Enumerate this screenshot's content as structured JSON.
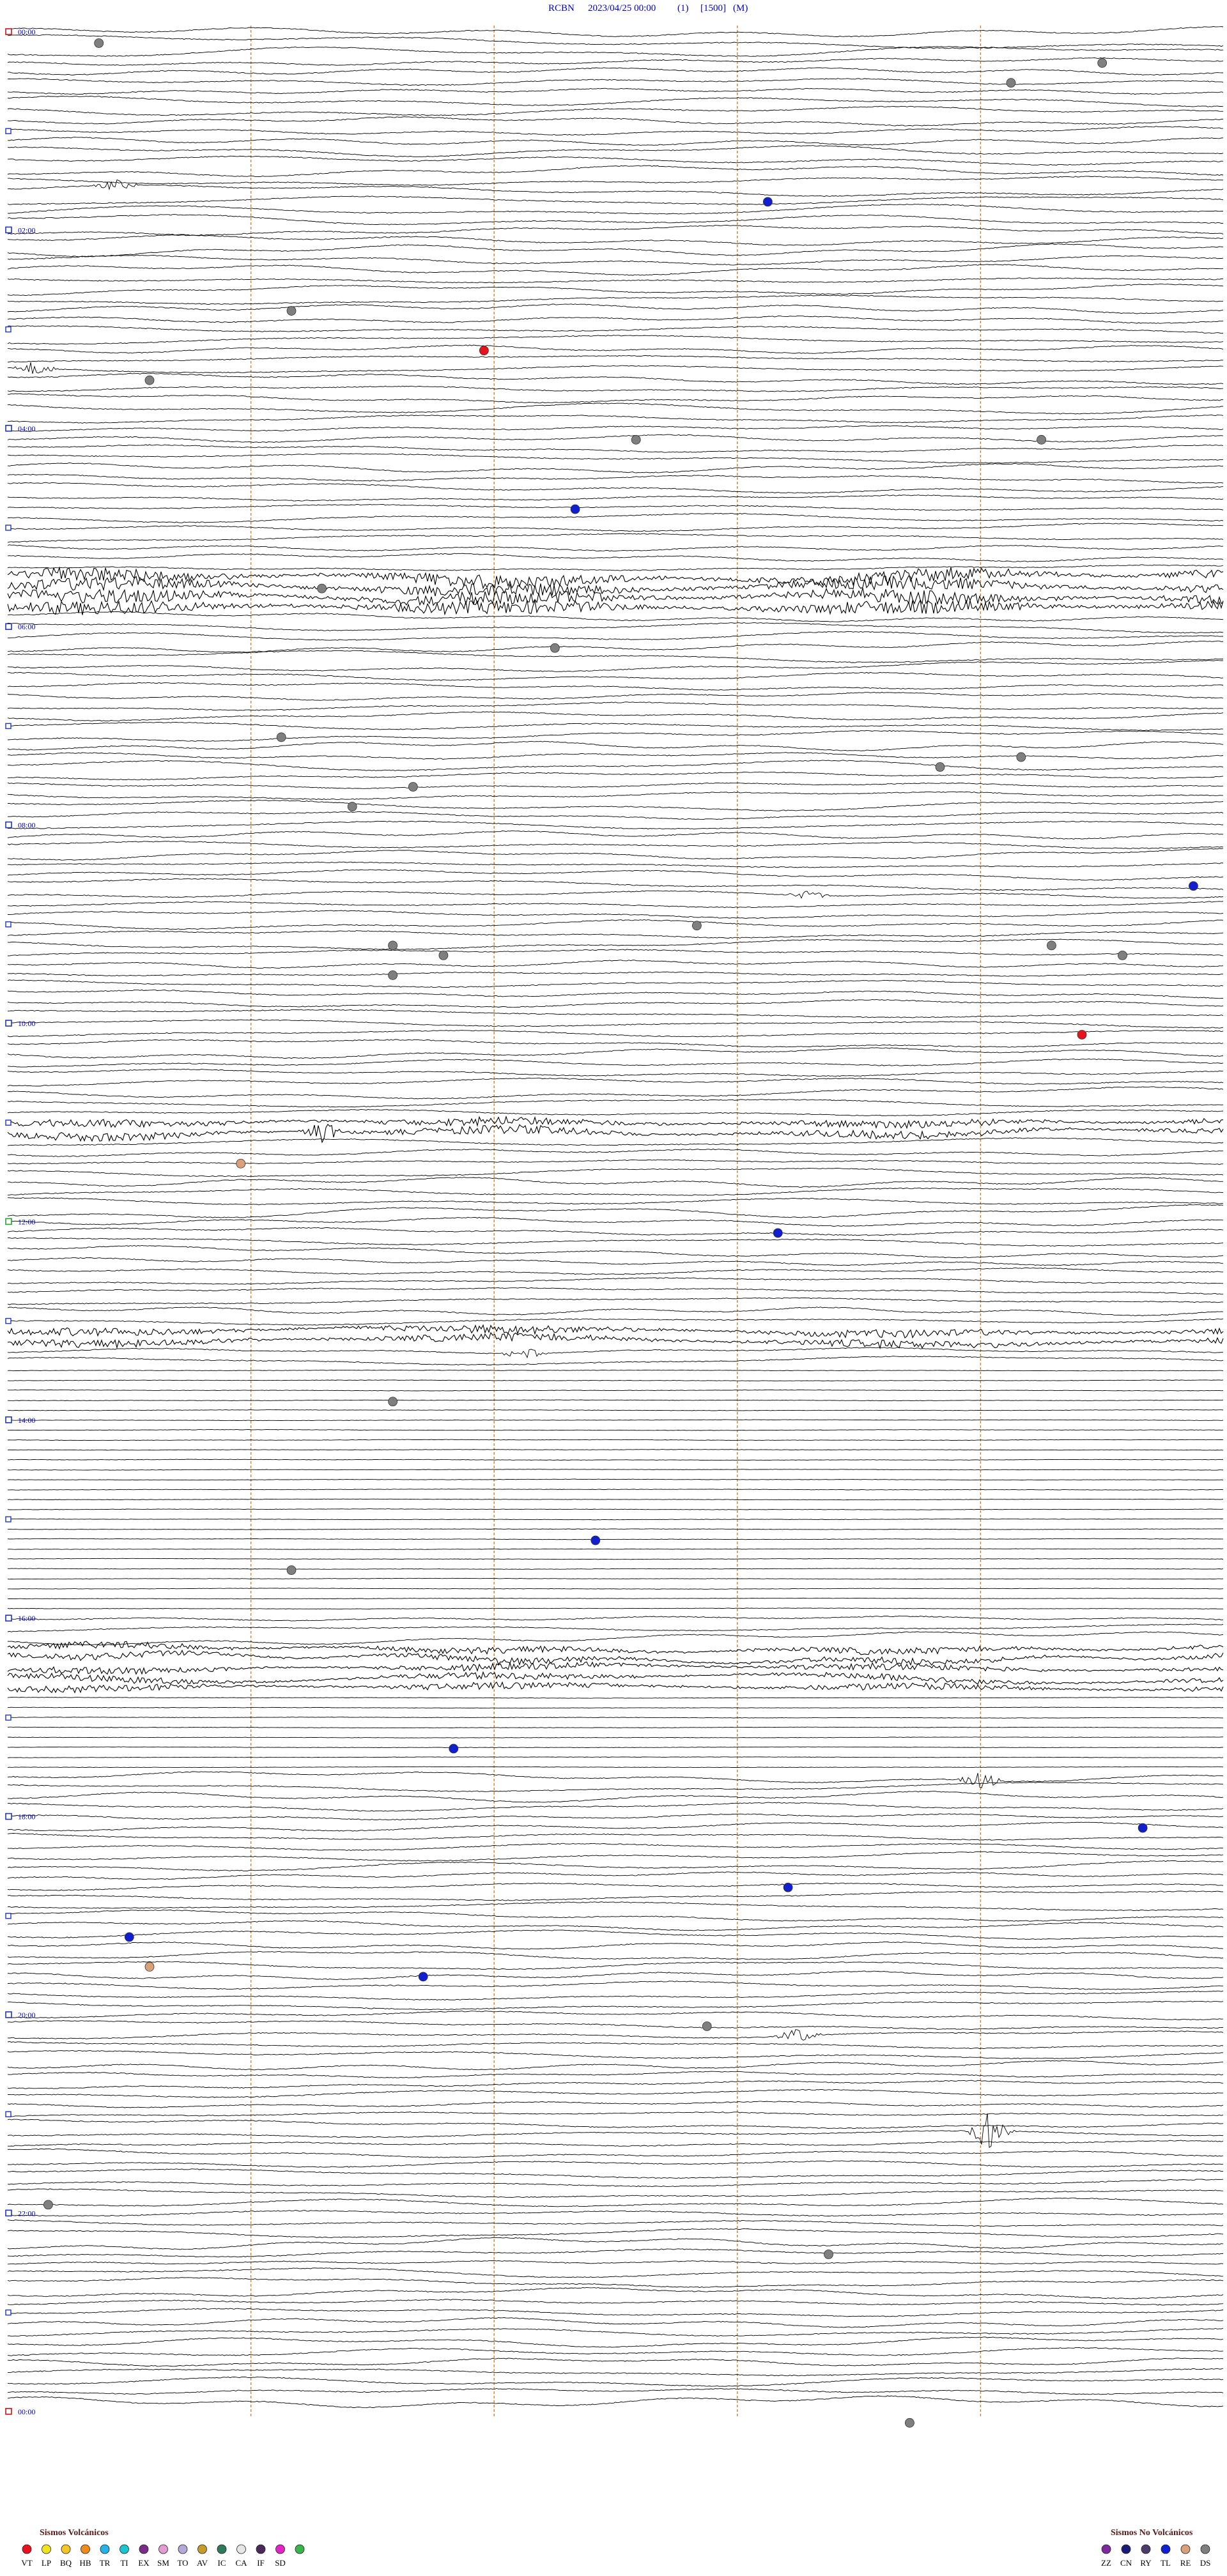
{
  "header": {
    "station": "RCBN",
    "date": "2023/04/25 00:00",
    "channel": "(1)",
    "scale": "[1500]",
    "mode": "(M)",
    "color": "#0000cc"
  },
  "chart_data": {
    "type": "seismogram-helicorder",
    "rows_total": 240,
    "row_minutes": 6,
    "hour_labels": [
      {
        "row": 0,
        "label": "00:00",
        "marker": "red"
      },
      {
        "row": 20,
        "label": "02:00",
        "marker": "blue"
      },
      {
        "row": 40,
        "label": "04:00",
        "marker": "blue"
      },
      {
        "row": 60,
        "label": "06:00",
        "marker": "blue"
      },
      {
        "row": 80,
        "label": "08:00",
        "marker": "blue"
      },
      {
        "row": 100,
        "label": "10:00",
        "marker": "blue"
      },
      {
        "row": 120,
        "label": "12:00",
        "marker": "green"
      },
      {
        "row": 140,
        "label": "14:00",
        "marker": "blue"
      },
      {
        "row": 160,
        "label": "16:00",
        "marker": "blue"
      },
      {
        "row": 180,
        "label": "18:00",
        "marker": "blue"
      },
      {
        "row": 200,
        "label": "20:00",
        "marker": "blue"
      },
      {
        "row": 220,
        "label": "22:00",
        "marker": "blue"
      },
      {
        "row": 240,
        "label": "00:00",
        "marker": "red"
      }
    ],
    "vertical_guides_minute": [
      1.2,
      2.4,
      3.6,
      4.8
    ],
    "flat_segment_rows": [
      135,
      175
    ],
    "noise_segments": [
      {
        "rows": [
          55,
          58
        ],
        "strength": 1.0
      },
      {
        "rows": [
          110,
          111
        ],
        "strength": 0.6
      },
      {
        "rows": [
          131,
          132
        ],
        "strength": 0.6
      },
      {
        "rows": [
          163,
          167
        ],
        "strength": 0.5
      }
    ],
    "event_bursts": [
      {
        "row": 16,
        "minute": 0.53,
        "amp": 0.6
      },
      {
        "row": 34,
        "minute": 0.14,
        "amp": 0.8
      },
      {
        "row": 87,
        "minute": 3.95,
        "amp": 0.5
      },
      {
        "row": 111,
        "minute": 1.55,
        "amp": 1.2
      },
      {
        "row": 133,
        "minute": 2.55,
        "amp": 0.6
      },
      {
        "row": 176,
        "minute": 4.8,
        "amp": 0.9
      },
      {
        "row": 202,
        "minute": 3.9,
        "amp": 0.8
      },
      {
        "row": 212,
        "minute": 4.85,
        "amp": 2.2
      }
    ],
    "event_markers": [
      {
        "row": 1,
        "minute": 0.45,
        "type": "DS"
      },
      {
        "row": 3,
        "minute": 5.4,
        "type": "DS"
      },
      {
        "row": 5,
        "minute": 4.95,
        "type": "DS"
      },
      {
        "row": 17,
        "minute": 3.75,
        "type": "TL"
      },
      {
        "row": 28,
        "minute": 1.4,
        "type": "DS"
      },
      {
        "row": 32,
        "minute": 2.35,
        "type": "VT"
      },
      {
        "row": 35,
        "minute": 0.7,
        "type": "DS"
      },
      {
        "row": 41,
        "minute": 3.1,
        "type": "DS"
      },
      {
        "row": 41,
        "minute": 5.1,
        "type": "DS"
      },
      {
        "row": 48,
        "minute": 2.8,
        "type": "TL"
      },
      {
        "row": 56,
        "minute": 1.55,
        "type": "DS"
      },
      {
        "row": 62,
        "minute": 2.7,
        "type": "DS"
      },
      {
        "row": 71,
        "minute": 1.35,
        "type": "DS"
      },
      {
        "row": 73,
        "minute": 5.0,
        "type": "DS"
      },
      {
        "row": 74,
        "minute": 4.6,
        "type": "DS"
      },
      {
        "row": 76,
        "minute": 2.0,
        "type": "DS"
      },
      {
        "row": 78,
        "minute": 1.7,
        "type": "DS"
      },
      {
        "row": 86,
        "minute": 5.85,
        "type": "TL"
      },
      {
        "row": 90,
        "minute": 3.4,
        "type": "DS"
      },
      {
        "row": 92,
        "minute": 1.9,
        "type": "DS"
      },
      {
        "row": 92,
        "minute": 5.15,
        "type": "DS"
      },
      {
        "row": 93,
        "minute": 2.15,
        "type": "DS"
      },
      {
        "row": 93,
        "minute": 5.5,
        "type": "DS"
      },
      {
        "row": 95,
        "minute": 1.9,
        "type": "DS"
      },
      {
        "row": 101,
        "minute": 5.3,
        "type": "VT"
      },
      {
        "row": 114,
        "minute": 1.15,
        "type": "RE"
      },
      {
        "row": 121,
        "minute": 3.8,
        "type": "TL"
      },
      {
        "row": 138,
        "minute": 1.9,
        "type": "DS"
      },
      {
        "row": 152,
        "minute": 2.9,
        "type": "TL"
      },
      {
        "row": 155,
        "minute": 1.4,
        "type": "DS"
      },
      {
        "row": 173,
        "minute": 2.2,
        "type": "TL"
      },
      {
        "row": 181,
        "minute": 5.6,
        "type": "TL"
      },
      {
        "row": 187,
        "minute": 3.85,
        "type": "TL"
      },
      {
        "row": 192,
        "minute": 0.6,
        "type": "TL"
      },
      {
        "row": 195,
        "minute": 0.7,
        "type": "RE"
      },
      {
        "row": 196,
        "minute": 2.05,
        "type": "TL"
      },
      {
        "row": 201,
        "minute": 3.45,
        "type": "DS"
      },
      {
        "row": 219,
        "minute": 0.2,
        "type": "DS"
      },
      {
        "row": 224,
        "minute": 4.05,
        "type": "DS"
      },
      {
        "row": 241,
        "minute": 4.45,
        "type": "DS"
      }
    ]
  },
  "legend": {
    "volcanic_title": "Sismos Volcánicos",
    "non_volcanic_title": "Sismos No Volcánicos",
    "volcanic": [
      {
        "code": "VT",
        "color": "#e8121c"
      },
      {
        "code": "LP",
        "color": "#f2e31f"
      },
      {
        "code": "BQ",
        "color": "#f5c52a"
      },
      {
        "code": "HB",
        "color": "#f08a1a"
      },
      {
        "code": "TR",
        "color": "#26b2e8"
      },
      {
        "code": "TI",
        "color": "#19c6d0"
      },
      {
        "code": "EX",
        "color": "#7a2a88"
      },
      {
        "code": "SM",
        "color": "#e59ad2"
      },
      {
        "code": "TO",
        "color": "#b5a7d8"
      },
      {
        "code": "AV",
        "color": "#c79a2a"
      },
      {
        "code": "IC",
        "color": "#2f7a5a"
      },
      {
        "code": "CA",
        "color": "#e6e6e6"
      },
      {
        "code": "IF",
        "color": "#4a2a5a"
      },
      {
        "code": "SD",
        "color": "#e324c8"
      },
      {
        "code": "",
        "color": "#39b54a"
      }
    ],
    "non_volcanic": [
      {
        "code": "ZZ",
        "color": "#7d2aa0"
      },
      {
        "code": "CN",
        "color": "#1a1a7a"
      },
      {
        "code": "RY",
        "color": "#4b3a6a"
      },
      {
        "code": "TL",
        "color": "#1020d0"
      },
      {
        "code": "RE",
        "color": "#d9a07a"
      },
      {
        "code": "DS",
        "color": "#7f7f7f"
      }
    ]
  },
  "colors": {
    "trace": "#000000",
    "guide": "#d97b2a",
    "hour_label": "#0000cc",
    "marker_red": "#d01010",
    "marker_blue": "#1a33cc",
    "marker_green": "#21a32a"
  }
}
